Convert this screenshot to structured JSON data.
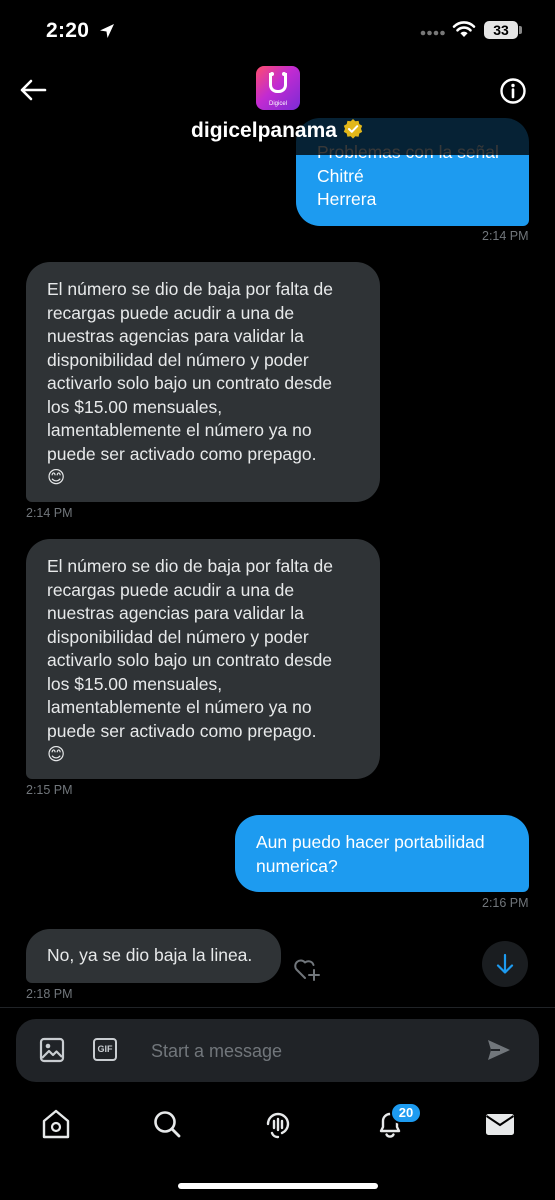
{
  "status_bar": {
    "time": "2:20",
    "battery": "33"
  },
  "header": {
    "name": "digicelpanama",
    "avatar_label": "Digicel"
  },
  "messages": [
    {
      "lines": [
        "Problemas con la señal",
        "Chitré",
        "Herrera"
      ],
      "time": "2:14 PM"
    },
    {
      "lines": [
        "El número se dio de baja por falta de",
        "recargas puede acudir a una de",
        "nuestras agencias para validar la",
        "disponibilidad del número y poder",
        "activarlo solo bajo un contrato desde",
        "los $15.00 mensuales,",
        "lamentablemente el número ya no",
        "puede ser activado como prepago.",
        "😊"
      ],
      "time": "2:14 PM"
    },
    {
      "lines": [
        "El número se dio de baja por falta de",
        "recargas puede acudir a una de",
        "nuestras agencias para validar la",
        "disponibilidad del número y poder",
        "activarlo solo bajo un contrato desde",
        "los $15.00 mensuales,",
        "lamentablemente el número ya no",
        "puede ser activado como prepago.",
        "😊"
      ],
      "time": "2:15 PM"
    },
    {
      "lines": [
        "Aun puedo hacer portabilidad",
        "numerica?"
      ],
      "time": "2:16 PM"
    },
    {
      "lines": [
        "No, ya se dio baja la linea."
      ],
      "time": "2:18 PM"
    }
  ],
  "composer": {
    "placeholder": "Start a message",
    "gif_label": "GIF"
  },
  "nav": {
    "notifications_badge": "20"
  },
  "colors": {
    "accent": "#1d9bf0",
    "received_bubble": "#2f3336",
    "background": "#000000"
  }
}
